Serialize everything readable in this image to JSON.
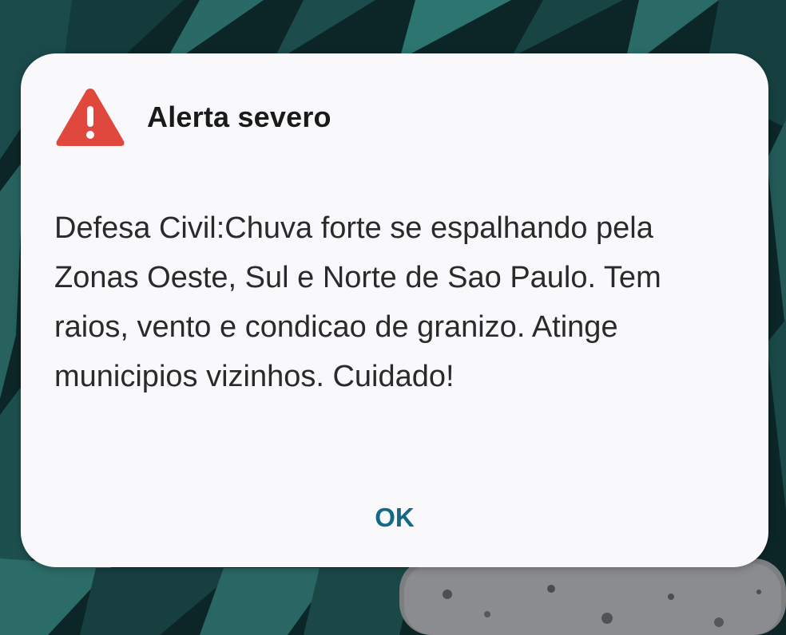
{
  "alert": {
    "title": "Alerta severo",
    "icon": "warning-triangle-icon",
    "message": "Defesa Civil:Chuva forte se espalhando pela Zonas Oeste, Sul e Norte de Sao Paulo. Tem raios, vento e condicao de granizo. Atinge municipios vizinhos. Cuidado!",
    "ok_label": "OK"
  },
  "colors": {
    "warning_icon": "#e0483d",
    "accent": "#136a86",
    "dialog_background": "#f9f9fc",
    "wallpaper": "#0d2a2c"
  }
}
